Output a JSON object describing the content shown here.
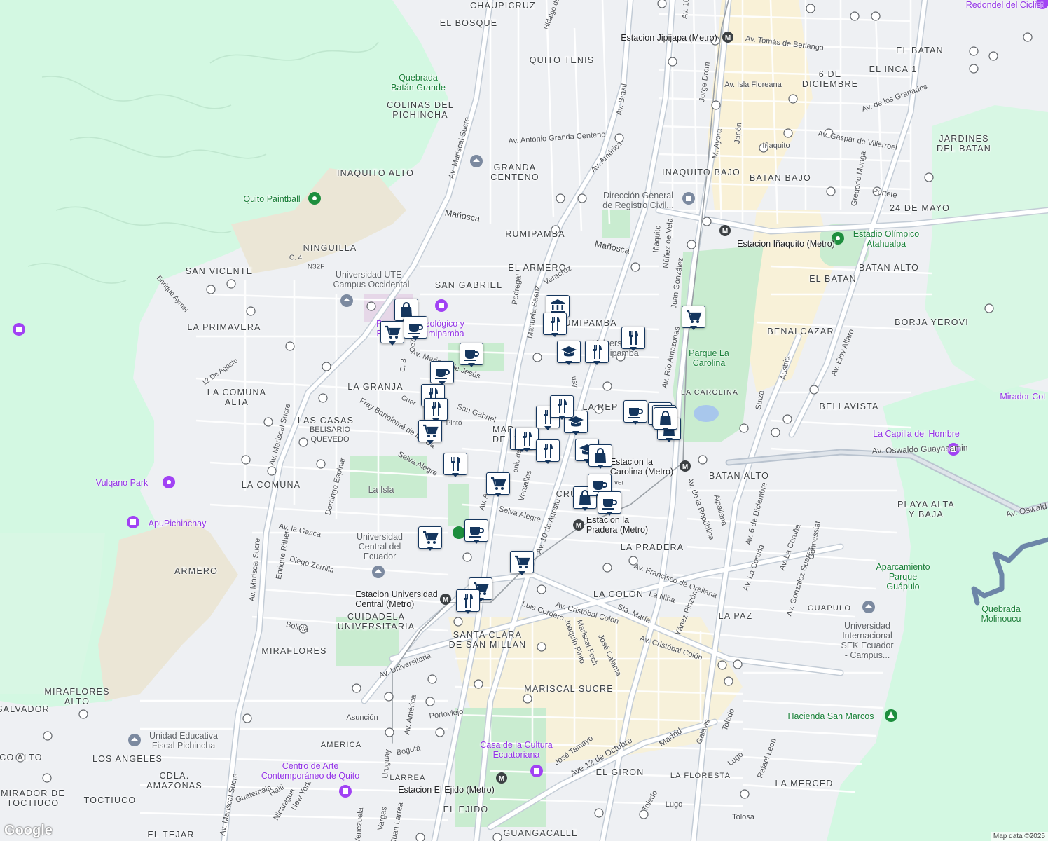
{
  "map": {
    "neighborhoods": [
      {
        "id": "chaupicruz",
        "text": "CHAUPICRUZ"
      },
      {
        "id": "el-bosque",
        "text": "EL BOSQUE"
      },
      {
        "id": "quito-tenis",
        "text": "QUITO TENIS"
      },
      {
        "id": "colinas-del-pichincha",
        "text": "COLINAS DEL\nPICHINCHA"
      },
      {
        "id": "inaquito-alto",
        "text": "INAQUITO ALTO"
      },
      {
        "id": "granda-centeno",
        "text": "GRANDA\nCENTENO"
      },
      {
        "id": "ninguilla",
        "text": "NINGUILLA"
      },
      {
        "id": "san-vicente",
        "text": "SAN VICENTE"
      },
      {
        "id": "san-gabriel",
        "text": "SAN GABRIEL"
      },
      {
        "id": "el-armero",
        "text": "EL ARMERO"
      },
      {
        "id": "la-primavera",
        "text": "LA PRIMAVERA"
      },
      {
        "id": "rumipamba",
        "text": "RUMIPAMBA"
      },
      {
        "id": "rumipamba-2",
        "text": "RUMIPAMBA"
      },
      {
        "id": "la-granja",
        "text": "LA GRANJA"
      },
      {
        "id": "la-comuna-alta",
        "text": "LA COMUNA\nALTA"
      },
      {
        "id": "las-casas",
        "text": "LAS CASAS"
      },
      {
        "id": "belisario-quevedo",
        "text": "BELISARIO\nQUEVEDO"
      },
      {
        "id": "la-comuna",
        "text": "LA COMUNA"
      },
      {
        "id": "armero",
        "text": "ARMERO"
      },
      {
        "id": "cuidadela-universitaria",
        "text": "CUIDADELA\nUNIVERSITARIA"
      },
      {
        "id": "miraflores",
        "text": "MIRAFLORES"
      },
      {
        "id": "miraflores-alto",
        "text": "MIRAFLORES\nALTO"
      },
      {
        "id": "salvador",
        "text": "SALVADOR"
      },
      {
        "id": "co-alto",
        "text": "CO ALTO"
      },
      {
        "id": "los-angeles",
        "text": "LOS ANGELES"
      },
      {
        "id": "cdla-amazonas",
        "text": "CDLA.\nAMAZONAS"
      },
      {
        "id": "mirador-de-toctiuco",
        "text": "MIRADOR DE\nTOCTIUCO"
      },
      {
        "id": "toctiuco",
        "text": "TOCTIUCO"
      },
      {
        "id": "el-tejar",
        "text": "EL TEJAR"
      },
      {
        "id": "santa-clara",
        "text": "SANTA CLARA\nDE SAN MILLAN"
      },
      {
        "id": "mariscal-sucre",
        "text": "MARISCAL SUCRE"
      },
      {
        "id": "el-giron",
        "text": "EL GIRON"
      },
      {
        "id": "la-floresta",
        "text": "LA FLORESTA"
      },
      {
        "id": "la-merced",
        "text": "LA MERCED"
      },
      {
        "id": "el-ejido",
        "text": "EL EJIDO"
      },
      {
        "id": "guangacalle",
        "text": "GUANGACALLE"
      },
      {
        "id": "la-pradera",
        "text": "LA PRADERA"
      },
      {
        "id": "la-colon",
        "text": "LA COLON"
      },
      {
        "id": "la-paz",
        "text": "LA PAZ"
      },
      {
        "id": "batan-alto",
        "text": "BATAN ALTO"
      },
      {
        "id": "batan-alto-2",
        "text": "BATAN ALTO"
      },
      {
        "id": "playa-alta",
        "text": "PLAYA ALTA\nY BAJA"
      },
      {
        "id": "bellavista",
        "text": "BELLAVISTA"
      },
      {
        "id": "benalcazar",
        "text": "BENALCAZAR"
      },
      {
        "id": "el-batan",
        "text": "EL BATAN"
      },
      {
        "id": "el-batan-2",
        "text": "EL BATAN"
      },
      {
        "id": "borja-yerovi",
        "text": "BORJA YEROVI"
      },
      {
        "id": "veinticuatro-de-mayo",
        "text": "24 DE MAYO"
      },
      {
        "id": "jardines-del-batan",
        "text": "JARDINES\nDEL BATAN"
      },
      {
        "id": "batan-bajo",
        "text": "BATAN BAJO"
      },
      {
        "id": "inaquito-bajo",
        "text": "INAQUITO BAJO"
      },
      {
        "id": "el-inca-1",
        "text": "EL INCA 1"
      },
      {
        "id": "seis-de-diciembre",
        "text": "6 DE\nDICIEMBRE"
      },
      {
        "id": "la-republica",
        "text": "LA REP"
      },
      {
        "id": "la-carolina-hood",
        "text": "LA CAROLINA"
      },
      {
        "id": "mariana-de-jesus-hood",
        "text": "MAR\nDE J"
      },
      {
        "id": "cruz",
        "text": "CRU"
      }
    ],
    "streets": [
      {
        "id": "av-tomas-de-berlanga",
        "text": "Av. Tomás de Berlanga"
      },
      {
        "id": "av-isla-floreana",
        "text": "Av. Isla Floreana"
      },
      {
        "id": "av-de-los-granados",
        "text": "Av. de los Granados"
      },
      {
        "id": "av-gaspar-de-villarroel",
        "text": "Av. Gaspar de Villarroel"
      },
      {
        "id": "av-antonio-granda-centeno",
        "text": "Av. Antonio Granda Centeno"
      },
      {
        "id": "av-america-north",
        "text": "Av. América"
      },
      {
        "id": "av-brasil",
        "text": "Av. Brasil"
      },
      {
        "id": "av-10",
        "text": "Av. 10"
      },
      {
        "id": "jorge-drom",
        "text": "Jorge Drom"
      },
      {
        "id": "m-ayora",
        "text": "M. Ayora"
      },
      {
        "id": "japon",
        "text": "Japón"
      },
      {
        "id": "inaquito-street",
        "text": "Iñaquito"
      },
      {
        "id": "gregorio-munga",
        "text": "Gregorio Munga"
      },
      {
        "id": "portete",
        "text": "Portete"
      },
      {
        "id": "manosca-west",
        "text": "Mañosca"
      },
      {
        "id": "manosca-east",
        "text": "Mañosca"
      },
      {
        "id": "veracruz",
        "text": "Veracruz"
      },
      {
        "id": "pedregal",
        "text": "Pedregal"
      },
      {
        "id": "manuela-saenz",
        "text": "Manuela Saenz"
      },
      {
        "id": "inaquito-v",
        "text": "Iñaquito"
      },
      {
        "id": "nunez-de-vela",
        "text": "Núñez de Vela"
      },
      {
        "id": "juan-gonzalez",
        "text": "Juan González"
      },
      {
        "id": "av-rio-amazonas",
        "text": "Av. Río Amazonas"
      },
      {
        "id": "austria",
        "text": "Austria"
      },
      {
        "id": "suiza",
        "text": "Suiza"
      },
      {
        "id": "av-eloy-alfaro",
        "text": "Av. Eloy Alfaro"
      },
      {
        "id": "av-mariscal-sucre-north",
        "text": "Av. Mariscal Sucre"
      },
      {
        "id": "av-mariscal-sucre-mid",
        "text": "Av. Mariscal Sucre"
      },
      {
        "id": "av-mariscal-sucre-south",
        "text": "Av. Mariscal Sucre"
      },
      {
        "id": "av-mariscal-sucre-bottom",
        "text": "Av. Mariscal Sucre"
      },
      {
        "id": "av-mariana-de-jesus",
        "text": "Av. Mariana de Jesús"
      },
      {
        "id": "san-gabriel-street",
        "text": "San Gabriel"
      },
      {
        "id": "fray-bartolome",
        "text": "Fray Bartolomé de las Ca"
      },
      {
        "id": "selva-alegre-1",
        "text": "Selva Alegre"
      },
      {
        "id": "selva-alegre-2",
        "text": "Selva Alegre"
      },
      {
        "id": "domingo-espinar",
        "text": "Domingo Espinar"
      },
      {
        "id": "av-la-gasca",
        "text": "Av. la Gasca"
      },
      {
        "id": "enrique-rither",
        "text": "Enrique Rither"
      },
      {
        "id": "diego-zorrilla",
        "text": "Diego Zorrilla"
      },
      {
        "id": "bolivia",
        "text": "Bolivia"
      },
      {
        "id": "av-universitaria",
        "text": "Av. Universitaria"
      },
      {
        "id": "asuncion",
        "text": "Asunción"
      },
      {
        "id": "av-america-south",
        "text": "Av. América"
      },
      {
        "id": "portoviejo",
        "text": "Portoviejo"
      },
      {
        "id": "america",
        "text": "AMERICA"
      },
      {
        "id": "bogota",
        "text": "Bogotá"
      },
      {
        "id": "uruguay",
        "text": "Uruguay"
      },
      {
        "id": "larrea",
        "text": "LARREA"
      },
      {
        "id": "vargas",
        "text": "Vargas"
      },
      {
        "id": "juan-larrea",
        "text": "Juan Larrea"
      },
      {
        "id": "venezuela",
        "text": "Venezuela"
      },
      {
        "id": "av-10-de-agosto",
        "text": "Av. 10 de Agosto"
      },
      {
        "id": "versalles",
        "text": "Versalles"
      },
      {
        "id": "av-cristobal-colon-1",
        "text": "Av. Cristóbal Colón"
      },
      {
        "id": "av-cristobal-colon-2",
        "text": "Av. Cristóbal Colón"
      },
      {
        "id": "luis-cordero",
        "text": "Luis Cordero"
      },
      {
        "id": "mariscal-foch",
        "text": "Mariscal Foch"
      },
      {
        "id": "joaquin-pinto",
        "text": "Joaquín Pinto"
      },
      {
        "id": "jose-calama",
        "text": "José Calama"
      },
      {
        "id": "av-francisco-de-orellana",
        "text": "Av. Francisco de Orellana"
      },
      {
        "id": "la-nina",
        "text": "La Niña"
      },
      {
        "id": "sta-maria",
        "text": "Sta. María"
      },
      {
        "id": "yanez-pinzon",
        "text": "Yánez Pinzón"
      },
      {
        "id": "av-de-la-republica",
        "text": "Av. de la República"
      },
      {
        "id": "alpallana",
        "text": "Alpallana"
      },
      {
        "id": "av-6-de-diciembre",
        "text": "Av. 6 de Diciembre"
      },
      {
        "id": "av-la-coruna-1",
        "text": "Av. La Coruña"
      },
      {
        "id": "av-la-coruna-2",
        "text": "Av. La Coruña"
      },
      {
        "id": "av-gonzalez-suarez",
        "text": "Av. Gonzalez Suarez"
      },
      {
        "id": "gonnessiat",
        "text": "Gonnessiat"
      },
      {
        "id": "guapulo",
        "text": "GUAPULO"
      },
      {
        "id": "av-oswaldo-guayasamin",
        "text": "Av. Oswaldo Guayasamin"
      },
      {
        "id": "av-oswald",
        "text": "Av. Oswald"
      },
      {
        "id": "jose-tamayo",
        "text": "José Tamayo"
      },
      {
        "id": "ave-12-de-octubre",
        "text": "Ave 12 de Octubre"
      },
      {
        "id": "madrid",
        "text": "Madrid"
      },
      {
        "id": "galavis",
        "text": "Galavis"
      },
      {
        "id": "toledo-1",
        "text": "Toledo"
      },
      {
        "id": "toledo-2",
        "text": "Toledo"
      },
      {
        "id": "lugo-1",
        "text": "Lugo"
      },
      {
        "id": "lugo-2",
        "text": "Lugo"
      },
      {
        "id": "rafael-leon",
        "text": "Rafael Leon"
      },
      {
        "id": "tolosa",
        "text": "Tolosa"
      },
      {
        "id": "guatemala",
        "text": "Guatemala"
      },
      {
        "id": "haiti",
        "text": "Haiti"
      },
      {
        "id": "nicaragua",
        "text": "Nicaragua"
      },
      {
        "id": "new-york",
        "text": "New York"
      },
      {
        "id": "c4",
        "text": "C. 4"
      },
      {
        "id": "n32f",
        "text": "N32F"
      },
      {
        "id": "enrique-aymer",
        "text": "Enrique Aymer"
      },
      {
        "id": "doce-de-agosto",
        "text": "12 De Agosto"
      },
      {
        "id": "hidalgo",
        "text": "Hidalgo de Pi"
      },
      {
        "id": "oe7a",
        "text": "Oe7A"
      },
      {
        "id": "cb",
        "text": "C. B"
      },
      {
        "id": "cuer",
        "text": "Cuer"
      },
      {
        "id": "pinto-street",
        "text": "Pinto"
      },
      {
        "id": "ulloa",
        "text": "onio de Ul"
      },
      {
        "id": "uruguay-v",
        "text": "uay"
      },
      {
        "id": "ver",
        "text": "ver"
      },
      {
        "id": "av-a",
        "text": "Av. A"
      }
    ],
    "places": [
      {
        "id": "quebrada-batan-grande",
        "text": "Quebrada\nBatán Grande",
        "style": "green"
      },
      {
        "id": "quito-paintball",
        "text": "Quito Paintball",
        "style": "green"
      },
      {
        "id": "universidad-ute",
        "text": "Universidad UTE -\nCampus Occidental",
        "style": "gray"
      },
      {
        "id": "parque-arqueologico",
        "text": "Parque Arqueológico y\nEcológico Rumipamba",
        "style": "purple"
      },
      {
        "id": "universidad-rumipamba",
        "text": "Universidad\nRumipamba",
        "style": "gray"
      },
      {
        "id": "direccion-registro-civil",
        "text": "Dirección General\nde Registro Civil...",
        "style": "gray"
      },
      {
        "id": "estadio-olimpico",
        "text": "Estadio Olímpico\nAtahualpa",
        "style": "green"
      },
      {
        "id": "parque-la-carolina",
        "text": "Parque La\nCarolina",
        "style": "green"
      },
      {
        "id": "vulqano-park",
        "text": "Vulqano Park",
        "style": "purple"
      },
      {
        "id": "apupichinchay",
        "text": "ApuPichinchay",
        "style": "purple"
      },
      {
        "id": "la-isla",
        "text": "La Isla",
        "style": "gray"
      },
      {
        "id": "universidad-central",
        "text": "Universidad\nCentral del\nEcuador",
        "style": "gray"
      },
      {
        "id": "la-capilla-del-hombre",
        "text": "La Capilla del Hombre",
        "style": "purple"
      },
      {
        "id": "mirador-cot",
        "text": "Mirador Cot",
        "style": "purple"
      },
      {
        "id": "aparcamiento-guapulo",
        "text": "Aparcamiento\nParque\nGuápulo",
        "style": "green"
      },
      {
        "id": "quebrada-molinoucu",
        "text": "Quebrada\nMolinoucu",
        "style": "green"
      },
      {
        "id": "universidad-sek",
        "text": "Universidad\nInternacional\nSEK Ecuador\n- Campus...",
        "style": "gray"
      },
      {
        "id": "hacienda-san-marcos",
        "text": "Hacienda San Marcos",
        "style": "green"
      },
      {
        "id": "unidad-educativa-pichincha",
        "text": "Unidad Educativa\nFiscal Pichincha",
        "style": "gray"
      },
      {
        "id": "centro-arte-contemporaneo",
        "text": "Centro de Arte\nContemporáneo de Quito",
        "style": "purple"
      },
      {
        "id": "casa-de-la-cultura",
        "text": "Casa de la Cultura\nEcuatoriana",
        "style": "purple"
      },
      {
        "id": "redondel-del-ciclista",
        "text": "Redondel del Ciclist",
        "style": "purple"
      }
    ],
    "metro_stations": [
      {
        "id": "estacion-jipijapa",
        "text": "Estacion Jipijapa (Metro)"
      },
      {
        "id": "estacion-inaquito",
        "text": "Estacion Iñaquito (Metro)"
      },
      {
        "id": "estacion-la-carolina",
        "text": "Estacion la\nCarolina (Metro)"
      },
      {
        "id": "estacion-la-pradera",
        "text": "Estacion la\nPradera (Metro)"
      },
      {
        "id": "estacion-universidad-central",
        "text": "Estacion Universidad\nCentral (Metro)"
      },
      {
        "id": "estacion-el-ejido",
        "text": "Estacion El Ejido (Metro)"
      }
    ],
    "markers": [
      {
        "id": "m1",
        "icon": "bag"
      },
      {
        "id": "m2",
        "icon": "cart"
      },
      {
        "id": "m3",
        "icon": "cup"
      },
      {
        "id": "m4",
        "icon": "cup"
      },
      {
        "id": "m5",
        "icon": "cup"
      },
      {
        "id": "m6",
        "icon": "fork-knife"
      },
      {
        "id": "m7",
        "icon": "fork-knife"
      },
      {
        "id": "m8",
        "icon": "cart"
      },
      {
        "id": "m9",
        "icon": "fork-knife"
      },
      {
        "id": "m10",
        "icon": "fork-knife"
      },
      {
        "id": "m11",
        "icon": "fork-knife"
      },
      {
        "id": "m12",
        "icon": "cart"
      },
      {
        "id": "m13",
        "icon": "cart"
      },
      {
        "id": "m14",
        "icon": "cart"
      },
      {
        "id": "m15",
        "icon": "cart"
      },
      {
        "id": "m16",
        "icon": "cart"
      },
      {
        "id": "m17",
        "icon": "fork-knife"
      },
      {
        "id": "m18",
        "icon": "graduation-cap"
      },
      {
        "id": "m19",
        "icon": "fork-knife"
      },
      {
        "id": "m20",
        "icon": "fork-knife"
      },
      {
        "id": "m21",
        "icon": "graduation-cap"
      },
      {
        "id": "m22",
        "icon": "fork-knife"
      },
      {
        "id": "m23",
        "icon": "graduation-cap"
      },
      {
        "id": "m24",
        "icon": "bag"
      },
      {
        "id": "m25",
        "icon": "bag"
      },
      {
        "id": "m26",
        "icon": "cup"
      },
      {
        "id": "m27",
        "icon": "bank"
      },
      {
        "id": "m28",
        "icon": "fork-knife"
      },
      {
        "id": "m29",
        "icon": "fork-knife"
      },
      {
        "id": "m30",
        "icon": "graduation-cap"
      },
      {
        "id": "m31",
        "icon": "cup"
      },
      {
        "id": "m32",
        "icon": "bag"
      },
      {
        "id": "m33",
        "icon": "cup"
      },
      {
        "id": "m34",
        "icon": "cup"
      },
      {
        "id": "m35",
        "icon": "bag"
      },
      {
        "id": "m36",
        "icon": "bag"
      },
      {
        "id": "m37",
        "icon": "cart"
      },
      {
        "id": "m38",
        "icon": "cup"
      }
    ]
  },
  "footer": {
    "logo": "Google",
    "attribution": "Map data ©2025"
  },
  "colors": {
    "marker_border": "#15365e",
    "park_green": "#c9ecd0",
    "hill_green": "#d3f8e2",
    "road_white": "#ffffff",
    "highway_gray": "#b9c3cf",
    "metro_line": "#9aa0a6",
    "river_blue": "#6d86a8",
    "urban_yellow": "#fbf1cf"
  }
}
